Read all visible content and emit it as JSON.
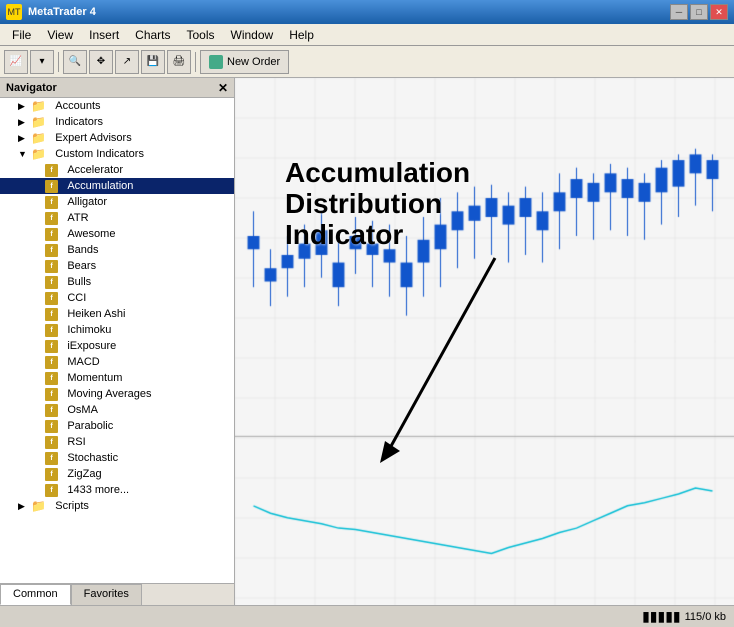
{
  "titleBar": {
    "title": "MetaTrader 4",
    "icon": "MT"
  },
  "menuBar": {
    "items": [
      "File",
      "View",
      "Insert",
      "Charts",
      "Tools",
      "Window",
      "Help"
    ]
  },
  "toolbar": {
    "newOrderLabel": "New Order"
  },
  "navigator": {
    "title": "Navigator",
    "tree": [
      {
        "id": "accounts",
        "label": "Accounts",
        "indent": 1,
        "type": "folder",
        "expanded": false
      },
      {
        "id": "indicators",
        "label": "Indicators",
        "indent": 1,
        "type": "folder",
        "expanded": false
      },
      {
        "id": "expert-advisors",
        "label": "Expert Advisors",
        "indent": 1,
        "type": "folder",
        "expanded": false
      },
      {
        "id": "custom-indicators",
        "label": "Custom Indicators",
        "indent": 1,
        "type": "folder",
        "expanded": true
      },
      {
        "id": "accelerator",
        "label": "Accelerator",
        "indent": 2,
        "type": "item"
      },
      {
        "id": "accumulation",
        "label": "Accumulation",
        "indent": 2,
        "type": "item",
        "selected": true
      },
      {
        "id": "alligator",
        "label": "Alligator",
        "indent": 2,
        "type": "item"
      },
      {
        "id": "atr",
        "label": "ATR",
        "indent": 2,
        "type": "item"
      },
      {
        "id": "awesome",
        "label": "Awesome",
        "indent": 2,
        "type": "item"
      },
      {
        "id": "bands",
        "label": "Bands",
        "indent": 2,
        "type": "item"
      },
      {
        "id": "bears",
        "label": "Bears",
        "indent": 2,
        "type": "item"
      },
      {
        "id": "bulls",
        "label": "Bulls",
        "indent": 2,
        "type": "item"
      },
      {
        "id": "cci",
        "label": "CCI",
        "indent": 2,
        "type": "item"
      },
      {
        "id": "heiken-ashi",
        "label": "Heiken Ashi",
        "indent": 2,
        "type": "item"
      },
      {
        "id": "ichimoku",
        "label": "Ichimoku",
        "indent": 2,
        "type": "item"
      },
      {
        "id": "iexposure",
        "label": "iExposure",
        "indent": 2,
        "type": "item"
      },
      {
        "id": "macd",
        "label": "MACD",
        "indent": 2,
        "type": "item"
      },
      {
        "id": "momentum",
        "label": "Momentum",
        "indent": 2,
        "type": "item"
      },
      {
        "id": "moving-averages",
        "label": "Moving Averages",
        "indent": 2,
        "type": "item"
      },
      {
        "id": "osma",
        "label": "OsMA",
        "indent": 2,
        "type": "item"
      },
      {
        "id": "parabolic",
        "label": "Parabolic",
        "indent": 2,
        "type": "item"
      },
      {
        "id": "rsi",
        "label": "RSI",
        "indent": 2,
        "type": "item"
      },
      {
        "id": "stochastic",
        "label": "Stochastic",
        "indent": 2,
        "type": "item"
      },
      {
        "id": "zigzag",
        "label": "ZigZag",
        "indent": 2,
        "type": "item"
      },
      {
        "id": "more",
        "label": "1433 more...",
        "indent": 2,
        "type": "item"
      },
      {
        "id": "scripts",
        "label": "Scripts",
        "indent": 1,
        "type": "folder",
        "expanded": false
      }
    ],
    "tabs": [
      {
        "id": "common",
        "label": "Common",
        "active": true
      },
      {
        "id": "favorites",
        "label": "Favorites",
        "active": false
      }
    ]
  },
  "annotation": {
    "line1": "Accumulation",
    "line2": "Distribution",
    "line3": "Indicator"
  },
  "statusBar": {
    "memory": "115/0 kb"
  }
}
